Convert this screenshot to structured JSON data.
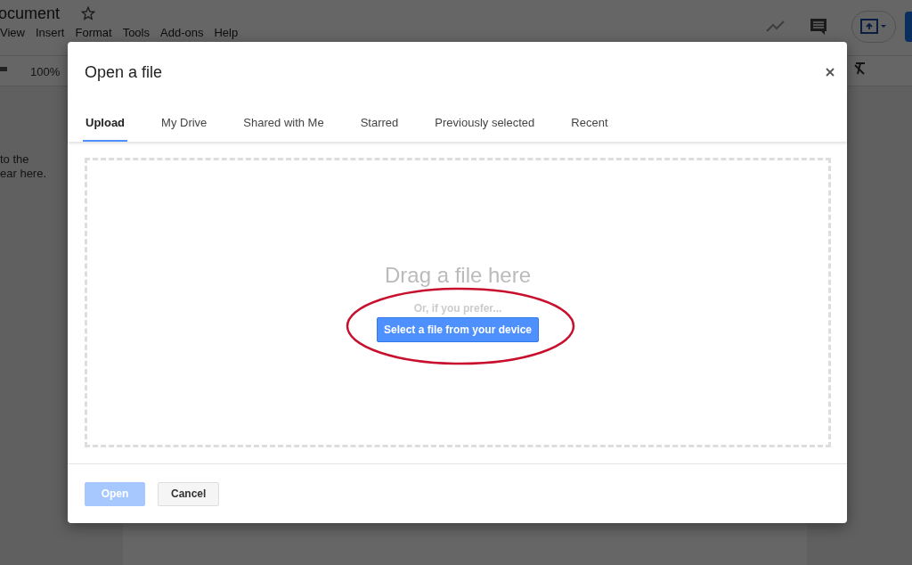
{
  "document": {
    "title": "ocument",
    "menu": [
      "View",
      "Insert",
      "Format",
      "Tools",
      "Add-ons",
      "Help"
    ],
    "zoom": "100%",
    "sidebar_text": "to the\near here."
  },
  "dialog": {
    "title": "Open a file",
    "tabs": [
      {
        "label": "Upload",
        "selected": true
      },
      {
        "label": "My Drive",
        "selected": false
      },
      {
        "label": "Shared with Me",
        "selected": false
      },
      {
        "label": "Starred",
        "selected": false
      },
      {
        "label": "Previously selected",
        "selected": false
      },
      {
        "label": "Recent",
        "selected": false
      }
    ],
    "drop_zone": {
      "heading": "Drag a file here",
      "hint": "Or, if you prefer...",
      "button": "Select a file from your device"
    },
    "buttons": [
      {
        "label": "Open",
        "kind": "primary",
        "disabled": true
      },
      {
        "label": "Cancel",
        "kind": "secondary",
        "disabled": false
      }
    ]
  }
}
